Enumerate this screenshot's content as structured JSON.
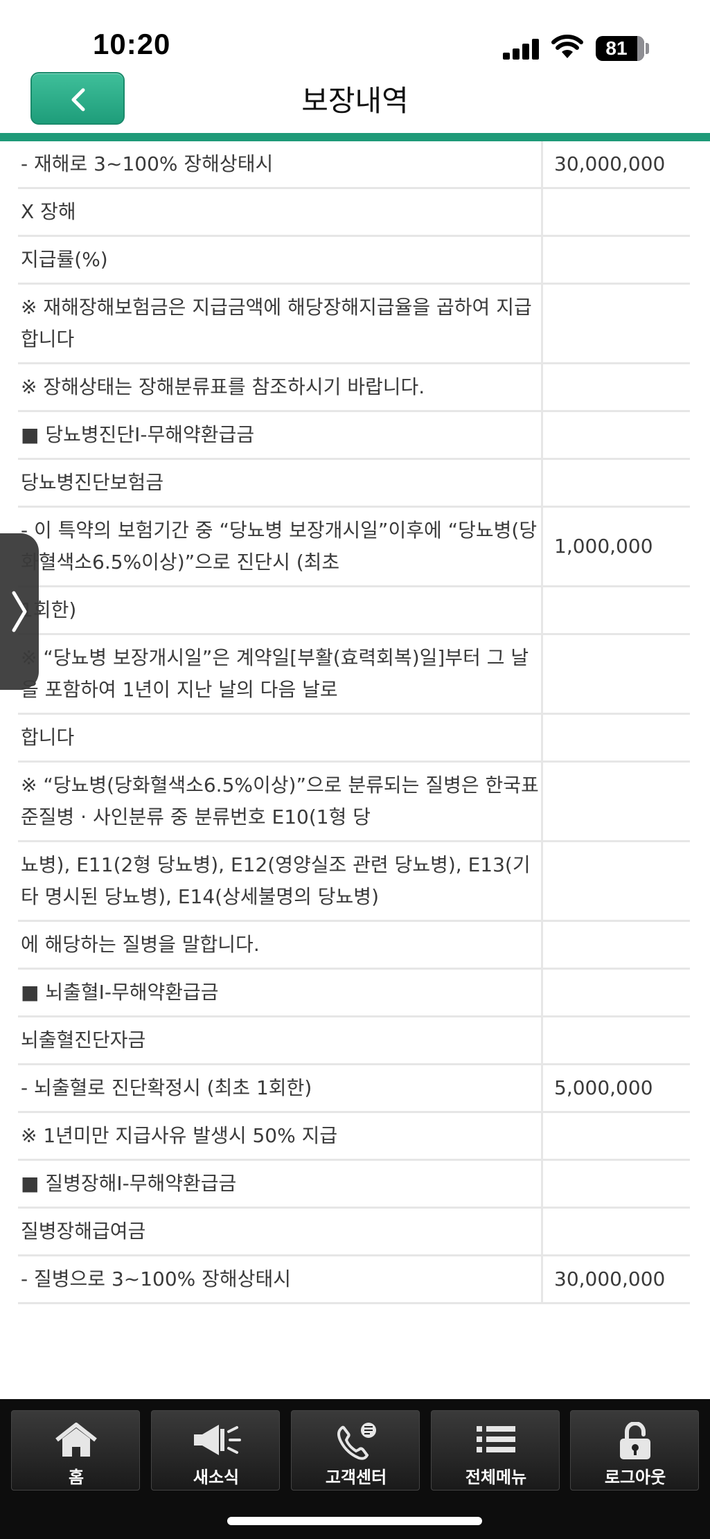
{
  "status_bar": {
    "time": "10:20",
    "battery": "81"
  },
  "header": {
    "title": "보장내역"
  },
  "rows": [
    {
      "desc": "- 재해로 3~100% 장해상태시",
      "amount": "30,000,000"
    },
    {
      "desc": "X 장해",
      "amount": ""
    },
    {
      "desc": "지급률(%)",
      "amount": ""
    },
    {
      "desc": "※ 재해장해보험금은 지급금액에 해당장해지급율을 곱하여 지급합니다",
      "amount": ""
    },
    {
      "desc": "※ 장해상태는 장해분류표를 참조하시기 바랍니다.",
      "amount": ""
    },
    {
      "desc": "■ 당뇨병진단I-무해약환급금",
      "amount": ""
    },
    {
      "desc": "당뇨병진단보험금",
      "amount": ""
    },
    {
      "desc": "- 이 특약의 보험기간 중 “당뇨병 보장개시일”이후에 “당뇨병(당화혈색소6.5%이상)”으로 진단시 (최초",
      "amount": "1,000,000"
    },
    {
      "desc": "1회한)",
      "amount": ""
    },
    {
      "desc": "※ “당뇨병 보장개시일”은 계약일[부활(효력회복)일]부터 그 날을 포함하여 1년이 지난 날의 다음 날로",
      "amount": ""
    },
    {
      "desc": "합니다",
      "amount": ""
    },
    {
      "desc": "※ “당뇨병(당화혈색소6.5%이상)”으로 분류되는 질병은 한국표준질병 · 사인분류 중 분류번호 E10(1형 당",
      "amount": ""
    },
    {
      "desc": "뇨병), E11(2형 당뇨병), E12(영양실조 관련 당뇨병), E13(기타 명시된 당뇨병), E14(상세불명의 당뇨병)",
      "amount": ""
    },
    {
      "desc": "에 해당하는 질병을 말합니다.",
      "amount": ""
    },
    {
      "desc": "■ 뇌출혈I-무해약환급금",
      "amount": ""
    },
    {
      "desc": "뇌출혈진단자금",
      "amount": ""
    },
    {
      "desc": "- 뇌출혈로 진단확정시 (최초 1회한)",
      "amount": "5,000,000"
    },
    {
      "desc": "※ 1년미만 지급사유 발생시 50% 지급",
      "amount": ""
    },
    {
      "desc": "■ 질병장해I-무해약환급금",
      "amount": ""
    },
    {
      "desc": "질병장해급여금",
      "amount": ""
    },
    {
      "desc": "- 질병으로 3~100% 장해상태시",
      "amount": "30,000,000"
    }
  ],
  "bottom_nav": [
    {
      "label": "홈",
      "icon": "home-icon"
    },
    {
      "label": "새소식",
      "icon": "megaphone-icon"
    },
    {
      "label": "고객센터",
      "icon": "phone-icon"
    },
    {
      "label": "전체메뉴",
      "icon": "menu-list-icon"
    },
    {
      "label": "로그아웃",
      "icon": "lock-icon"
    }
  ],
  "colors": {
    "accent": "#1e9a78",
    "nav_bg": "#0d0d0d"
  }
}
